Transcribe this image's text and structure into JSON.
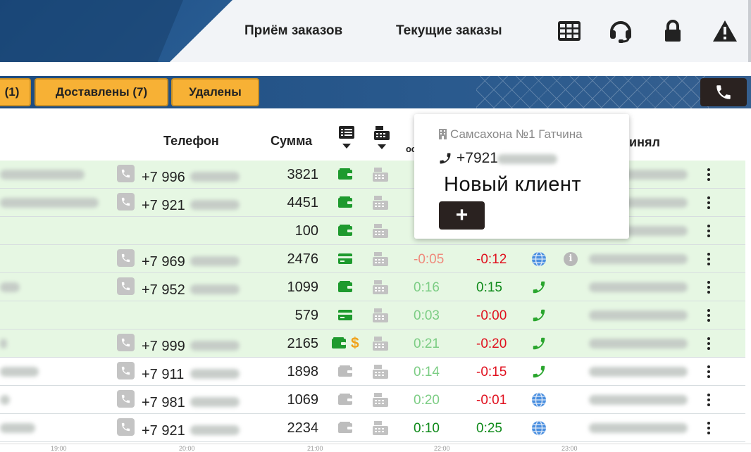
{
  "header": {
    "nav": [
      "Приём заказов",
      "Текущие заказы"
    ],
    "icons": [
      "table-grid-icon",
      "headset-icon",
      "lock-icon",
      "warning-icon"
    ]
  },
  "tabs": [
    "(1)",
    "Доставлены (7)",
    "Удалены"
  ],
  "table": {
    "headers": {
      "phone": "Телефон",
      "sum": "Сумма",
      "accepted": "инял",
      "col_short": "ос"
    },
    "rows": [
      {
        "phone": "+7 996",
        "sum": "3821",
        "t1": "",
        "t2": "",
        "green": true
      },
      {
        "phone": "+7 921",
        "sum": "4451",
        "t1": "",
        "t2": "",
        "green": true
      },
      {
        "phone": "",
        "sum": "100",
        "t1": "",
        "t2": "",
        "green": true
      },
      {
        "phone": "+7 969",
        "sum": "2476",
        "t1": "-0:05",
        "t2": "-0:12",
        "green": true
      },
      {
        "phone": "+7 952",
        "sum": "1099",
        "t1": "0:16",
        "t2": "0:15",
        "green": true
      },
      {
        "phone": "",
        "sum": "579",
        "t1": "0:03",
        "t2": "-0:00",
        "green": true
      },
      {
        "phone": "+7 999",
        "sum": "2165",
        "t1": "0:21",
        "t2": "-0:20",
        "green": true
      },
      {
        "phone": "+7 911",
        "sum": "1898",
        "t1": "0:14",
        "t2": "-0:15",
        "green": false
      },
      {
        "phone": "+7 981",
        "sum": "1069",
        "t1": "0:20",
        "t2": "-0:01",
        "green": false
      },
      {
        "phone": "+7 921",
        "sum": "2234",
        "t1": "0:10",
        "t2": "0:25",
        "green": false
      }
    ]
  },
  "popup": {
    "location": "Самсахона №1 Гатчина",
    "phone": "+7921",
    "title": "Новый клиент",
    "add_label": "+"
  },
  "axis": [
    "19:00",
    "20:00",
    "21:00",
    "22:00",
    "23:00"
  ],
  "colors": {
    "accent": "#f7b135",
    "header_blue": "#1d4c80",
    "row_green": "#e6f7e3",
    "pay_green": "#1e9a2e",
    "negative_red": "#e0101e",
    "positive_green": "#0f8a1a"
  }
}
